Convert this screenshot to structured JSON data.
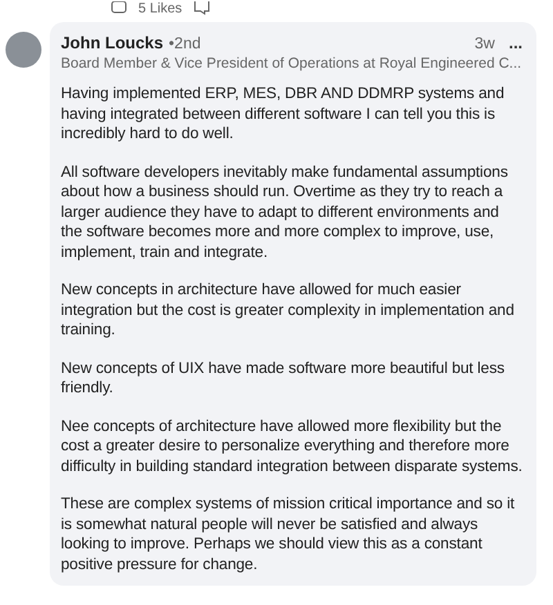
{
  "reactions": {
    "likes": "5 Likes"
  },
  "comment": {
    "author": "John Loucks",
    "degree": "•2nd",
    "headline": "Board Member & Vice President of Operations at Royal Engineered C...",
    "time": "3w",
    "menu": "...",
    "paragraphs": [
      "Having implemented ERP, MES, DBR AND DDMRP systems and having integrated between different software I can tell you this is incredibly hard to do well.",
      "All software developers inevitably make fundamental assumptions about how a business should run. Overtime as they try to reach a larger audience they have to adapt to different environments and the software becomes more and more complex to improve, use, implement, train and integrate.",
      "New concepts in architecture have allowed for much easier integration but the cost is greater complexity in implementation and training.",
      "New concepts of UIX have made software more beautiful but less friendly.",
      "Nee concepts of architecture have allowed more flexibility but the cost a greater desire to personalize everything and therefore more difficulty in building standard integration between disparate systems.",
      "These are complex systems of mission critical importance and so it is somewhat natural people will never be satisfied and always looking to improve. Perhaps we should view this as a constant positive pressure for change."
    ]
  }
}
